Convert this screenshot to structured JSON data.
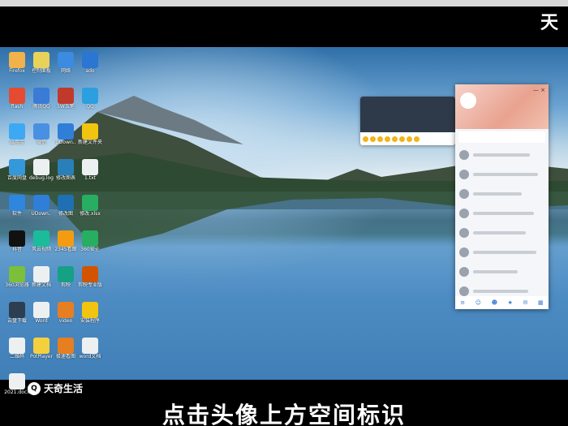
{
  "brand_corner": "天",
  "watermark": {
    "logo_text": "天奇生活"
  },
  "caption": "点击头像上方空间标识",
  "desktop_icons": [
    {
      "label": "Firefox",
      "color": "#f0b24a"
    },
    {
      "label": "控制面板",
      "color": "#e8d25a"
    },
    {
      "label": "网络",
      "color": "#3b8be0"
    },
    {
      "label": "ado",
      "color": "#2a76d2"
    },
    {
      "label": "flash",
      "color": "#e34c32"
    },
    {
      "label": "腾讯QQ",
      "color": "#3a7bd5"
    },
    {
      "label": "5W五笔",
      "color": "#c0392b"
    },
    {
      "label": "QQ",
      "color": "#2b9fe0"
    },
    {
      "label": "应用宝",
      "color": "#3da9f5"
    },
    {
      "label": "微信",
      "color": "#4a90e2"
    },
    {
      "label": "UDown..",
      "color": "#2f7ed8"
    },
    {
      "label": "新建文件夹",
      "color": "#f1c40f"
    },
    {
      "label": "百度网盘",
      "color": "#3498db"
    },
    {
      "label": "debug.log",
      "color": "#ecf0f1"
    },
    {
      "label": "修改图表",
      "color": "#2980b9"
    },
    {
      "label": "1.txt",
      "color": "#ecf0f1"
    },
    {
      "label": "软件",
      "color": "#2e86de"
    },
    {
      "label": "UDown..",
      "color": "#2f7ed8"
    },
    {
      "label": "修改图",
      "color": "#1f6fb2"
    },
    {
      "label": "修改.xlsx",
      "color": "#27ae60"
    },
    {
      "label": "抖音",
      "color": "#111111"
    },
    {
      "label": "风云视频",
      "color": "#1abc9c"
    },
    {
      "label": "2345看图",
      "color": "#f39c12"
    },
    {
      "label": "360安全",
      "color": "#27ae60"
    },
    {
      "label": "360浏览器",
      "color": "#7bbf3b"
    },
    {
      "label": "新建文档",
      "color": "#ecf0f1"
    },
    {
      "label": "剪映",
      "color": "#16a085"
    },
    {
      "label": "剪映专业版",
      "color": "#d35400"
    },
    {
      "label": "云盘下载",
      "color": "#2c3e50"
    },
    {
      "label": "Word",
      "color": "#ecf0f1"
    },
    {
      "label": "video",
      "color": "#e67e22"
    },
    {
      "label": "安装程序",
      "color": "#f1c40f"
    },
    {
      "label": "二维码",
      "color": "#ecf0f1"
    },
    {
      "label": "PotPlayer",
      "color": "#f4d03f"
    },
    {
      "label": "极速看图",
      "color": "#e67e22"
    },
    {
      "label": "word文档",
      "color": "#ecf0f1"
    },
    {
      "label": "2021.docx",
      "color": "#ecf0f1"
    }
  ],
  "qq_panel": {
    "controls": "— × ",
    "footer_icons": [
      "menu-icon",
      "contacts-icon",
      "group-icon",
      "space-icon",
      "mail-icon",
      "more-icon"
    ]
  }
}
